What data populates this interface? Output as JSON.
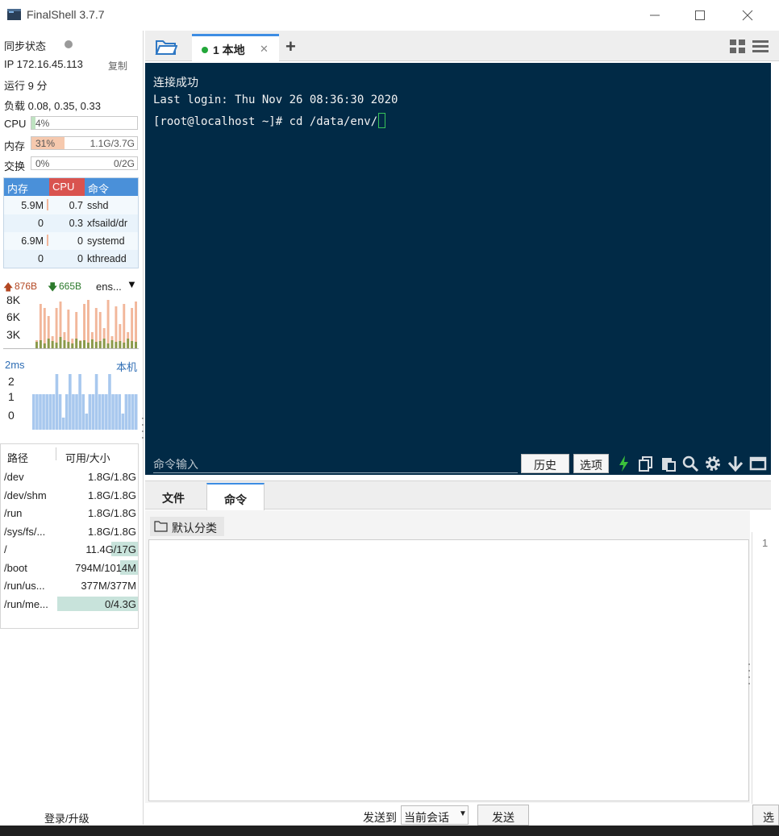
{
  "window": {
    "title": "FinalShell 3.7.7",
    "minimize_icon": "minimize-icon",
    "maximize_icon": "maximize-icon",
    "close_icon": "close-icon"
  },
  "sidebar": {
    "sync_label": "同步状态",
    "ip_label": "IP 172.16.45.113",
    "copy_label": "复制",
    "uptime": "运行 9 分",
    "load": "负载 0.08, 0.35, 0.33",
    "cpu": {
      "label": "CPU",
      "percent_text": "4%",
      "fraction": 0.04
    },
    "memory": {
      "label": "内存",
      "percent_text": "31%",
      "fraction": 0.31,
      "total": "1.1G/3.7G"
    },
    "swap": {
      "label": "交换",
      "percent_text": "0%",
      "fraction": 0.0,
      "total": "0/2G"
    },
    "process_table": {
      "headers": [
        "内存",
        "CPU",
        "命令"
      ],
      "rows": [
        {
          "mem": "5.9M",
          "cpu": "0.7",
          "cmd": "sshd"
        },
        {
          "mem": "0",
          "cpu": "0.3",
          "cmd": "xfsaild/dr"
        },
        {
          "mem": "6.9M",
          "cpu": "0",
          "cmd": "systemd"
        },
        {
          "mem": "0",
          "cpu": "0",
          "cmd": "kthreadd"
        }
      ]
    },
    "network": {
      "upload": "876B",
      "download": "665B",
      "interface": "ens...",
      "y_labels": [
        "8K",
        "6K",
        "3K"
      ]
    },
    "ping": {
      "latency": "2ms",
      "host": "本机",
      "y_labels": [
        "2",
        "1",
        "0"
      ]
    },
    "disk": {
      "headers": [
        "路径",
        "可用/大小"
      ],
      "rows": [
        {
          "path": "/dev",
          "value": "1.8G/1.8G",
          "used": 0.0
        },
        {
          "path": "/dev/shm",
          "value": "1.8G/1.8G",
          "used": 0.0
        },
        {
          "path": "/run",
          "value": "1.8G/1.8G",
          "used": 0.0
        },
        {
          "path": "/sys/fs/...",
          "value": "1.8G/1.8G",
          "used": 0.0
        },
        {
          "path": "/",
          "value": "11.4G/17G",
          "used": 0.33
        },
        {
          "path": "/boot",
          "value": "794M/1014M",
          "used": 0.22
        },
        {
          "path": "/run/us...",
          "value": "377M/377M",
          "used": 0.0
        },
        {
          "path": "/run/me...",
          "value": "0/4.3G",
          "used": 1.0
        }
      ]
    },
    "login_upgrade": "登录/升级"
  },
  "tabs": {
    "local_tab": "1 本地"
  },
  "terminal": {
    "lines": [
      "连接成功",
      "Last login: Thu Nov 26 08:36:30 2020",
      "[root@localhost ~]# cd /data/env/"
    ],
    "command_placeholder": "命令输入",
    "history_button": "历史",
    "options_button": "选项"
  },
  "bottom_panel": {
    "tabs": [
      "文件",
      "命令"
    ],
    "category_tab": "默认分类",
    "line_number": "1",
    "send_to_label": "发送到",
    "send_target": "当前会话",
    "send_button": "发送",
    "right_cut_label": "选"
  },
  "colors": {
    "terminal_bg": "#012a46",
    "accent_blue": "#3d8de3",
    "status_green": "#23a73a",
    "proc_cpu_header": "#d9534f",
    "proc_mem_header": "#4a90d9",
    "mem_fill": "#f6c9ae",
    "cpu_fill": "#bfe3c1",
    "net_up": "#f2b79b",
    "net_down": "#8a9a4a",
    "ping_bar": "#a8c8ee"
  }
}
